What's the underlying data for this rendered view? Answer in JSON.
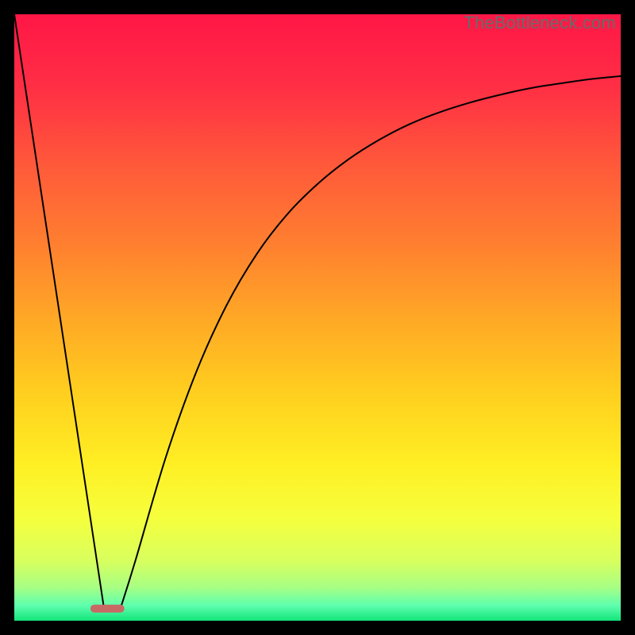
{
  "watermark": "TheBottleneck.com",
  "chart_data": {
    "type": "line",
    "title": "",
    "xlabel": "",
    "ylabel": "",
    "xlim": [
      0,
      100
    ],
    "ylim": [
      0,
      100
    ],
    "grid": false,
    "legend": false,
    "series": [
      {
        "name": "segment-left",
        "x": [
          0,
          14.8
        ],
        "y": [
          100,
          2
        ]
      },
      {
        "name": "trough-marker",
        "x": [
          13.2,
          17.5
        ],
        "y": [
          2.0,
          2.0
        ]
      },
      {
        "name": "segment-right",
        "x": [
          17.5,
          20,
          25,
          30,
          35,
          40,
          45,
          50,
          55,
          60,
          65,
          70,
          75,
          80,
          85,
          90,
          95,
          100
        ],
        "y": [
          2.0,
          10,
          27,
          41,
          52,
          60.5,
          67,
          72,
          76,
          79.2,
          81.8,
          83.8,
          85.4,
          86.7,
          87.8,
          88.6,
          89.3,
          89.8
        ]
      }
    ],
    "background_gradient": {
      "stops": [
        {
          "offset": 0.0,
          "color": "#ff1747"
        },
        {
          "offset": 0.12,
          "color": "#ff2f45"
        },
        {
          "offset": 0.25,
          "color": "#ff5a3a"
        },
        {
          "offset": 0.38,
          "color": "#ff8030"
        },
        {
          "offset": 0.5,
          "color": "#ffa826"
        },
        {
          "offset": 0.62,
          "color": "#ffce1f"
        },
        {
          "offset": 0.74,
          "color": "#ffef24"
        },
        {
          "offset": 0.83,
          "color": "#f6ff3d"
        },
        {
          "offset": 0.9,
          "color": "#d9ff5e"
        },
        {
          "offset": 0.945,
          "color": "#a8ff84"
        },
        {
          "offset": 0.975,
          "color": "#5effaf"
        },
        {
          "offset": 1.0,
          "color": "#14e57a"
        }
      ]
    },
    "trough_marker_color": "#c86a64",
    "curve_color": "#000000"
  }
}
